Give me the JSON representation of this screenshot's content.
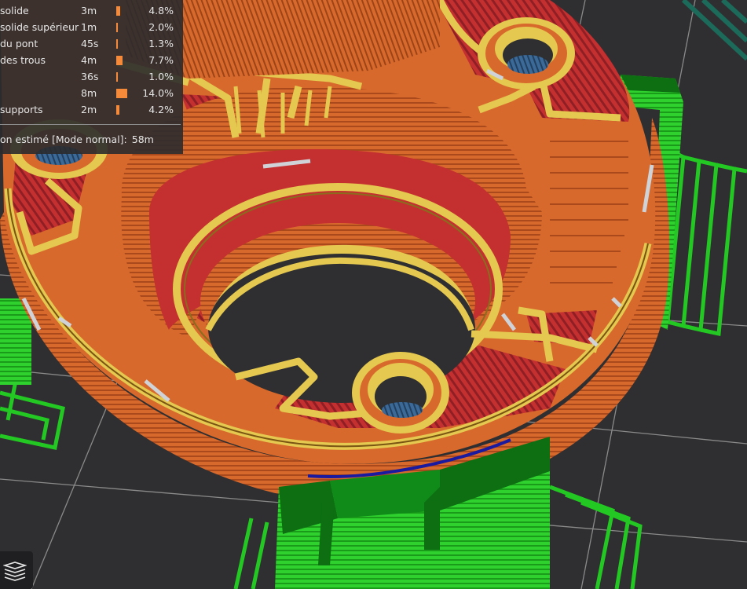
{
  "legend": {
    "rows": [
      {
        "name": "solide",
        "time": "3m",
        "pct": "4.8%",
        "fraction": 0.048
      },
      {
        "name": "solide supérieur",
        "time": "1m",
        "pct": "2.0%",
        "fraction": 0.02
      },
      {
        "name": "du pont",
        "time": "45s",
        "pct": "1.3%",
        "fraction": 0.013
      },
      {
        "name": "des trous",
        "time": "4m",
        "pct": "7.7%",
        "fraction": 0.077
      },
      {
        "name": "",
        "time": "36s",
        "pct": "1.0%",
        "fraction": 0.01
      },
      {
        "name": "",
        "time": "8m",
        "pct": "14.0%",
        "fraction": 0.14
      },
      {
        "name": "supports",
        "time": "2m",
        "pct": "4.2%",
        "fraction": 0.042
      }
    ],
    "total_label": "on estimé [Mode normal]:",
    "total_value": "58m",
    "bar_color": "#f58a3b"
  },
  "colors": {
    "background": "#2f2f31",
    "grid": "#8a8a8a",
    "perimeter_external": "#d8692c",
    "perimeter_internal": "#e4c84f",
    "infill": "#c43030",
    "solid_infill": "#3b6a99",
    "bridge": "#cfd3d8",
    "support": "#1fae1f",
    "support_dark": "#0d6e12",
    "wipe_path": "#1a1aa0"
  },
  "icons": {
    "layers_button": "layers-icon"
  }
}
